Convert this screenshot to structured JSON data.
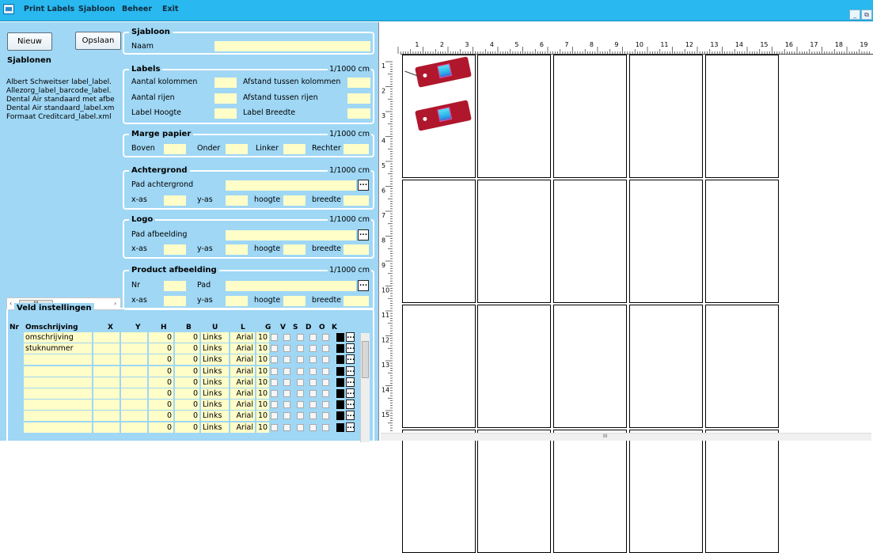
{
  "menu": {
    "items": [
      "Print Labels",
      "Sjabloon",
      "Beheer",
      "Exit"
    ]
  },
  "window_buttons": [
    "_",
    "⧉"
  ],
  "toolbar": {
    "new_label": "Nieuw",
    "save_label": "Opslaan"
  },
  "sjablonen": {
    "title": "Sjablonen",
    "items": [
      "Albert Schweitser label_label.",
      "Allezorg_label_barcode_label.",
      "Dental Air standaard met afbe",
      "Dental Air standaard_label.xm",
      "Formaat Creditcard_label.xml"
    ]
  },
  "sjabloon": {
    "title": "Sjabloon",
    "naam_label": "Naam",
    "naam_value": ""
  },
  "labels": {
    "title": "Labels",
    "unit": "1/1000 cm",
    "aantal_kolommen": "Aantal kolommen",
    "aantal_rijen": "Aantal rijen",
    "label_hoogte": "Label Hoogte",
    "afstand_kolommen": "Afstand tussen kolommen",
    "afstand_rijen": "Afstand tussen rijen",
    "label_breedte": "Label Breedte"
  },
  "marge": {
    "title": "Marge papier",
    "unit": "1/1000 cm",
    "boven": "Boven",
    "onder": "Onder",
    "linker": "Linker",
    "rechter": "Rechter"
  },
  "achtergrond": {
    "title": "Achtergrond",
    "unit": "1/1000 cm",
    "pad": "Pad achtergrond",
    "xas": "x-as",
    "yas": "y-as",
    "hoogte": "hoogte",
    "breedte": "breedte",
    "browse": "..."
  },
  "logo": {
    "title": "Logo",
    "unit": "1/1000 cm",
    "pad": "Pad afbeelding",
    "xas": "x-as",
    "yas": "y-as",
    "hoogte": "hoogte",
    "breedte": "breedte",
    "browse": "..."
  },
  "product": {
    "title": "Product afbeelding",
    "unit": "1/1000 cm",
    "nr": "Nr",
    "pad": "Pad",
    "xas": "x-as",
    "yas": "y-as",
    "hoogte": "hoogte",
    "breedte": "breedte",
    "browse": "..."
  },
  "scrollbar": {
    "left": "‹",
    "thumb": "III",
    "right": "›"
  },
  "veld": {
    "title": "Veld instellingen",
    "headers": [
      "Nr",
      "Omschrijving",
      "X",
      "Y",
      "H",
      "B",
      "U",
      "L",
      "G",
      "V",
      "S",
      "D",
      "O",
      "K"
    ],
    "rows": [
      {
        "omschrijving": "omschrijving",
        "h": "0",
        "b": "0",
        "u": "Links",
        "l": "Arial",
        "g": "10"
      },
      {
        "omschrijving": "stuknummer",
        "h": "0",
        "b": "0",
        "u": "Links",
        "l": "Arial",
        "g": "10"
      },
      {
        "omschrijving": "",
        "h": "0",
        "b": "0",
        "u": "Links",
        "l": "Arial",
        "g": "10"
      },
      {
        "omschrijving": "",
        "h": "0",
        "b": "0",
        "u": "Links",
        "l": "Arial",
        "g": "10"
      },
      {
        "omschrijving": "",
        "h": "0",
        "b": "0",
        "u": "Links",
        "l": "Arial",
        "g": "10"
      },
      {
        "omschrijving": "",
        "h": "0",
        "b": "0",
        "u": "Links",
        "l": "Arial",
        "g": "10"
      },
      {
        "omschrijving": "",
        "h": "0",
        "b": "0",
        "u": "Links",
        "l": "Arial",
        "g": "10"
      },
      {
        "omschrijving": "",
        "h": "0",
        "b": "0",
        "u": "Links",
        "l": "Arial",
        "g": "10"
      },
      {
        "omschrijving": "",
        "h": "0",
        "b": "0",
        "u": "Links",
        "l": "Arial",
        "g": "10"
      }
    ],
    "browse": "..."
  },
  "ruler": {
    "h_numbers": [
      "1",
      "2",
      "3",
      "4",
      "5",
      "6",
      "7",
      "8",
      "9",
      "10",
      "11",
      "12",
      "13",
      "14",
      "15",
      "16",
      "17",
      "18",
      "19"
    ],
    "v_numbers": [
      "1",
      "2",
      "3",
      "4",
      "5",
      "6",
      "7",
      "8",
      "9",
      "10",
      "11",
      "12",
      "13",
      "14",
      "15"
    ]
  },
  "preview": {
    "scroll_thumb": "III"
  }
}
